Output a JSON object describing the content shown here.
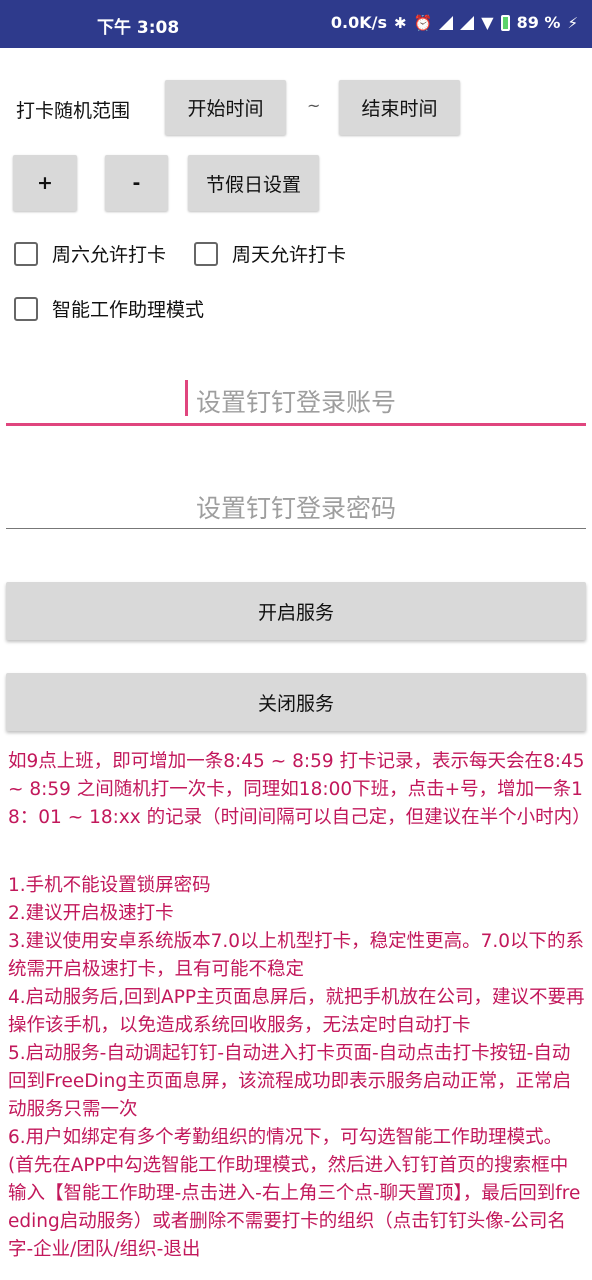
{
  "status_bar": {
    "time": "下午 3:08",
    "net_speed": "0.0K/s",
    "battery": "89 %"
  },
  "range": {
    "label": "打卡随机范围",
    "start_button": "开始时间",
    "separator": "~",
    "end_button": "结束时间"
  },
  "actions": {
    "plus": "+",
    "minus": "-",
    "holiday": "节假日设置"
  },
  "checkboxes": {
    "saturday": "周六允许打卡",
    "sunday": "周天允许打卡",
    "smart_mode": "智能工作助理模式"
  },
  "fields": {
    "account_placeholder": "设置钉钉登录账号",
    "password_placeholder": "设置钉钉登录密码"
  },
  "service": {
    "start": "开启服务",
    "stop": "关闭服务"
  },
  "intro": "如9点上班，即可增加一条8:45 ~ 8:59 打卡记录，表示每天会在8:45 ~ 8:59 之间随机打一次卡，同理如18:00下班，点击+号，增加一条18：01 ~ 18:xx 的记录（时间间隔可以自己定，但建议在半个小时内）",
  "notes": [
    "1.手机不能设置锁屏密码",
    "2.建议开启极速打卡",
    "3.建议使用安卓系统版本7.0以上机型打卡，稳定性更高。7.0以下的系统需开启极速打卡，且有可能不稳定",
    "4.启动服务后,回到APP主页面息屏后，就把手机放在公司，建议不要再操作该手机，以免造成系统回收服务，无法定时自动打卡",
    "5.启动服务-自动调起钉钉-自动进入打卡页面-自动点击打卡按钮-自动回到FreeDing主页面息屏，该流程成功即表示服务启动正常，正常启动服务只需一次",
    "6.用户如绑定有多个考勤组织的情况下，可勾选智能工作助理模式。(首先在APP中勾选智能工作助理模式，然后进入钉钉首页的搜索框中输入【智能工作助理-点击进入-右上角三个点-聊天置顶】，最后回到freeding启动服务）或者删除不需要打卡的组织（点击钉钉头像-公司名字-企业/团队/组织-退出"
  ],
  "colors": {
    "status_bar": "#2e3a8c",
    "accent": "#e0457e",
    "note_text": "#c2185b"
  }
}
